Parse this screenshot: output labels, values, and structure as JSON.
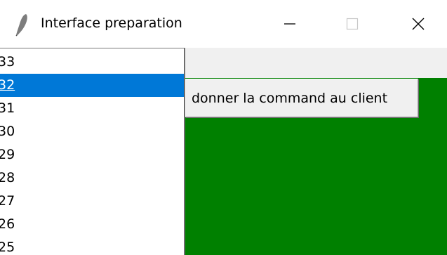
{
  "window": {
    "title": "Interface preparation",
    "icon": "feather-icon",
    "controls": {
      "minimize": "minimize-icon",
      "maximize": "maximize-icon",
      "close": "close-icon"
    }
  },
  "listbox": {
    "items": [
      "33",
      "32",
      "31",
      "30",
      "29",
      "28",
      "27",
      "26",
      "25"
    ],
    "selected": "32"
  },
  "main": {
    "button_label": "donner la command au client",
    "canvas_color": "#008000"
  },
  "colors": {
    "selection": "#0078d7",
    "canvas": "#008000",
    "window_bg": "#f0f0f0"
  }
}
